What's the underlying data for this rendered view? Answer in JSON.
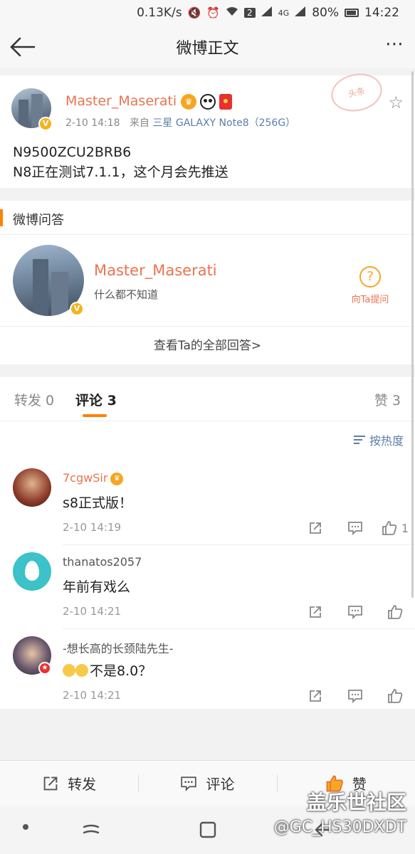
{
  "status_bar": {
    "speed": "0.13K/s",
    "notif_count": "2",
    "network": "4G",
    "battery": "80%",
    "time": "14:22"
  },
  "nav": {
    "title": "微博正文"
  },
  "post": {
    "username": "Master_Maserati",
    "time": "2-10 14:18",
    "source_prefix": "来自",
    "device": "三星 GALAXY Note8（256G）",
    "stamp": "头条",
    "line1": "N9500ZCU2BRB6",
    "line2": "N8正在测试7.1.1，这个月会先推送"
  },
  "qa": {
    "title": "微博问答",
    "name": "Master_Maserati",
    "desc": "什么都不知道",
    "ask_label": "向Ta提问",
    "footer": "查看Ta的全部回答>"
  },
  "tabs": {
    "repost": "转发 0",
    "comment": "评论 3",
    "like": "赞 3",
    "sort": "按热度"
  },
  "comments": [
    {
      "name": "7cgwSir",
      "text": "s8正式版！",
      "time": "2-10 14:19",
      "likes": "1",
      "name_color": "#eb7350"
    },
    {
      "name": "thanatos2057",
      "text": "年前有戏么",
      "time": "2-10 14:21",
      "likes": "",
      "name_color": "#555555"
    },
    {
      "name": "-想长高的长颈陆先生-",
      "text": "不是8.0？",
      "time": "2-10 14:21",
      "likes": "",
      "name_color": "#555555"
    }
  ],
  "bottom": {
    "repost": "转发",
    "comment": "评论",
    "like": "赞"
  },
  "watermark": {
    "line1": "盖乐世社区",
    "line2": "@GC_HS30DXDT"
  }
}
